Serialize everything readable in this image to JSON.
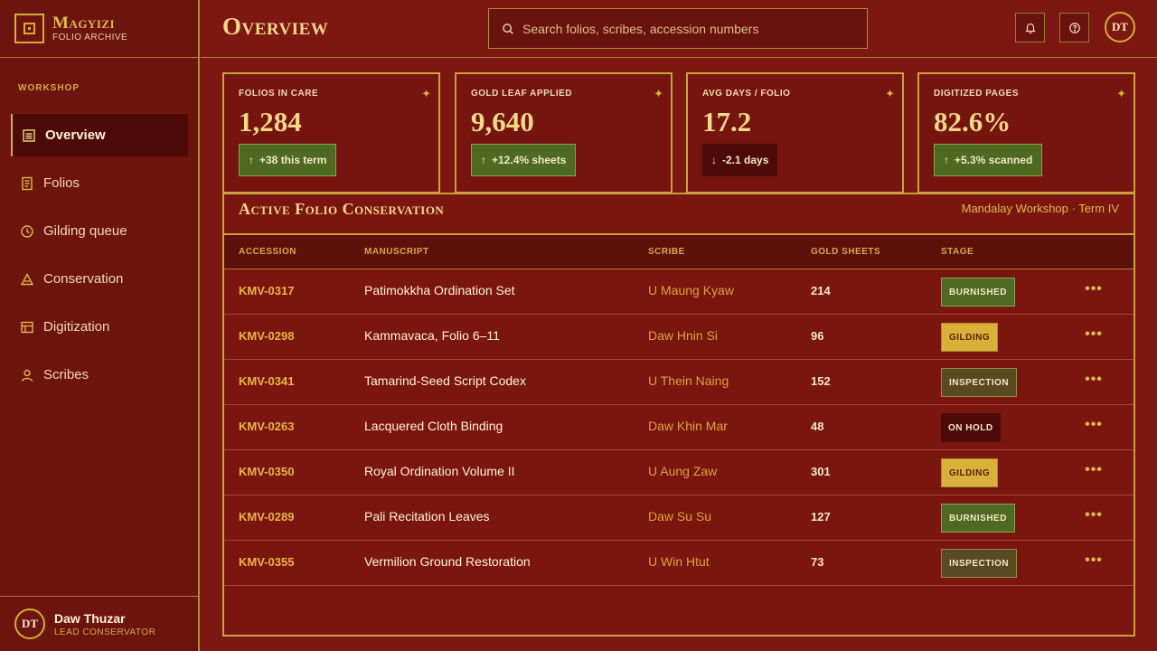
{
  "brand": {
    "name": "Magyizi",
    "subtitle": "FOLIO ARCHIVE"
  },
  "sidebar": {
    "section_label": "WORKSHOP",
    "items": [
      {
        "label": "Overview",
        "icon": "overview-icon",
        "active": true
      },
      {
        "label": "Folios",
        "icon": "document-icon"
      },
      {
        "label": "Gilding queue",
        "icon": "clock-icon"
      },
      {
        "label": "Conservation",
        "icon": "triangle-icon"
      },
      {
        "label": "Digitization",
        "icon": "grid-icon"
      },
      {
        "label": "Scribes",
        "icon": "person-icon"
      }
    ],
    "profile": {
      "initials": "DT",
      "name": "Daw Thuzar",
      "role": "LEAD CONSERVATOR"
    }
  },
  "header": {
    "title": "Overview",
    "search_placeholder": "Search folios, scribes, accession numbers",
    "avatar_initials": "DT"
  },
  "stats": [
    {
      "label": "FOLIOS IN CARE",
      "value": "1,284",
      "delta": "+38 this term",
      "trend": "up"
    },
    {
      "label": "GOLD LEAF APPLIED",
      "value": "9,640",
      "delta": "+12.4% sheets",
      "trend": "up"
    },
    {
      "label": "AVG DAYS / FOLIO",
      "value": "17.2",
      "delta": "-2.1 days",
      "trend": "down"
    },
    {
      "label": "DIGITIZED PAGES",
      "value": "82.6%",
      "delta": "+5.3% scanned",
      "trend": "up"
    }
  ],
  "table": {
    "title": "Active Folio Conservation",
    "meta": "Mandalay Workshop · Term IV",
    "columns": [
      "ACCESSION",
      "MANUSCRIPT",
      "SCRIBE",
      "GOLD SHEETS",
      "STAGE"
    ],
    "rows": [
      {
        "accession": "KMV-0317",
        "manuscript": "Patimokkha Ordination Set",
        "scribe": "U Maung Kyaw",
        "gold": "214",
        "stage": "BURNISHED"
      },
      {
        "accession": "KMV-0298",
        "manuscript": "Kammavaca, Folio 6–11",
        "scribe": "Daw Hnin Si",
        "gold": "96",
        "stage": "GILDING"
      },
      {
        "accession": "KMV-0341",
        "manuscript": "Tamarind-Seed Script Codex",
        "scribe": "U Thein Naing",
        "gold": "152",
        "stage": "INSPECTION"
      },
      {
        "accession": "KMV-0263",
        "manuscript": "Lacquered Cloth Binding",
        "scribe": "Daw Khin Mar",
        "gold": "48",
        "stage": "ON HOLD"
      },
      {
        "accession": "KMV-0350",
        "manuscript": "Royal Ordination Volume II",
        "scribe": "U Aung Zaw",
        "gold": "301",
        "stage": "GILDING"
      },
      {
        "accession": "KMV-0289",
        "manuscript": "Pali Recitation Leaves",
        "scribe": "Daw Su Su",
        "gold": "127",
        "stage": "BURNISHED"
      },
      {
        "accession": "KMV-0355",
        "manuscript": "Vermilion Ground Restoration",
        "scribe": "U Win Htut",
        "gold": "73",
        "stage": "INSPECTION"
      }
    ]
  },
  "colors": {
    "background": "#7d1712",
    "gold": "#d4af37",
    "success": "#4e6a22"
  }
}
